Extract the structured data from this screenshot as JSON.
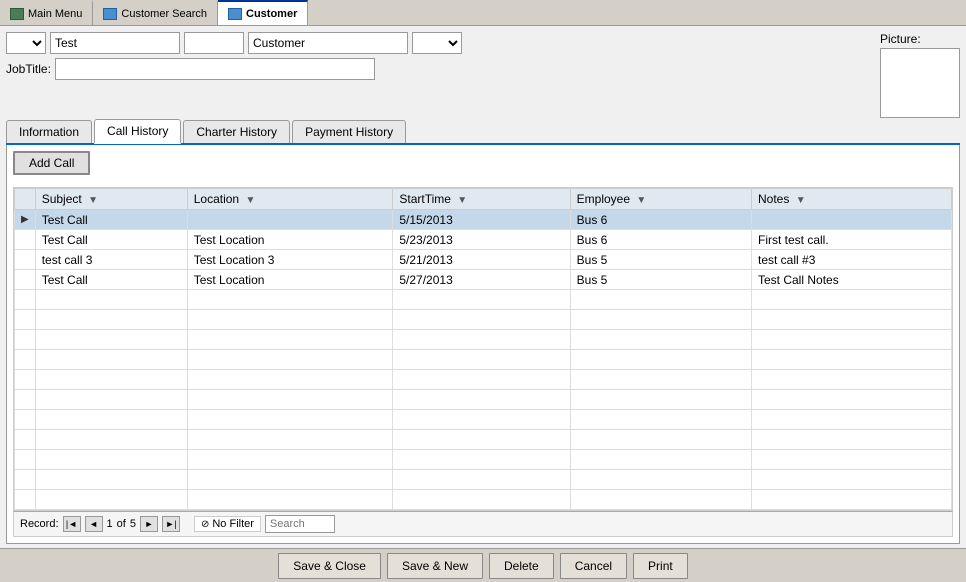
{
  "titlebar": {
    "tabs": [
      {
        "id": "main-menu",
        "label": "Main Menu",
        "icon": "home-icon",
        "active": false
      },
      {
        "id": "customer-search",
        "label": "Customer Search",
        "icon": "table-icon",
        "active": false
      },
      {
        "id": "customer",
        "label": "Customer",
        "icon": "table-icon",
        "active": true
      }
    ]
  },
  "form": {
    "prefix_placeholder": "",
    "first_name": "Test",
    "last_name": "",
    "customer_type": "Customer",
    "suffix_placeholder": "",
    "jobtitle_label": "JobTitle:",
    "jobtitle_value": "",
    "picture_label": "Picture:"
  },
  "inner_tabs": [
    {
      "id": "information",
      "label": "Information",
      "active": false
    },
    {
      "id": "call-history",
      "label": "Call History",
      "active": true
    },
    {
      "id": "charter-history",
      "label": "Charter History",
      "active": false
    },
    {
      "id": "payment-history",
      "label": "Payment History",
      "active": false
    }
  ],
  "call_history": {
    "add_button_label": "Add Call",
    "columns": [
      {
        "id": "subject",
        "label": "Subject"
      },
      {
        "id": "location",
        "label": "Location"
      },
      {
        "id": "start_time",
        "label": "StartTime"
      },
      {
        "id": "employee",
        "label": "Employee"
      },
      {
        "id": "notes",
        "label": "Notes"
      }
    ],
    "rows": [
      {
        "id": 1,
        "subject": "Test Call",
        "location": "",
        "start_time": "5/15/2013",
        "employee": "Bus 6",
        "notes": "",
        "selected": true
      },
      {
        "id": 2,
        "subject": "Test Call",
        "location": "Test Location",
        "start_time": "5/23/2013",
        "employee": "Bus 6",
        "notes": "First test call.",
        "selected": false
      },
      {
        "id": 3,
        "subject": "test call 3",
        "location": "Test Location 3",
        "start_time": "5/21/2013",
        "employee": "Bus 5",
        "notes": "test call #3",
        "selected": false
      },
      {
        "id": 4,
        "subject": "Test Call",
        "location": "Test Location",
        "start_time": "5/27/2013",
        "employee": "Bus 5",
        "notes": "Test Call Notes",
        "selected": false
      }
    ]
  },
  "statusbar": {
    "record_label": "Record:",
    "current_record": "1",
    "total_records": "5",
    "of_label": "of",
    "no_filter_label": "No Filter",
    "search_placeholder": "Search"
  },
  "toolbar": {
    "save_close_label": "Save & Close",
    "save_new_label": "Save & New",
    "delete_label": "Delete",
    "cancel_label": "Cancel",
    "print_label": "Print"
  }
}
